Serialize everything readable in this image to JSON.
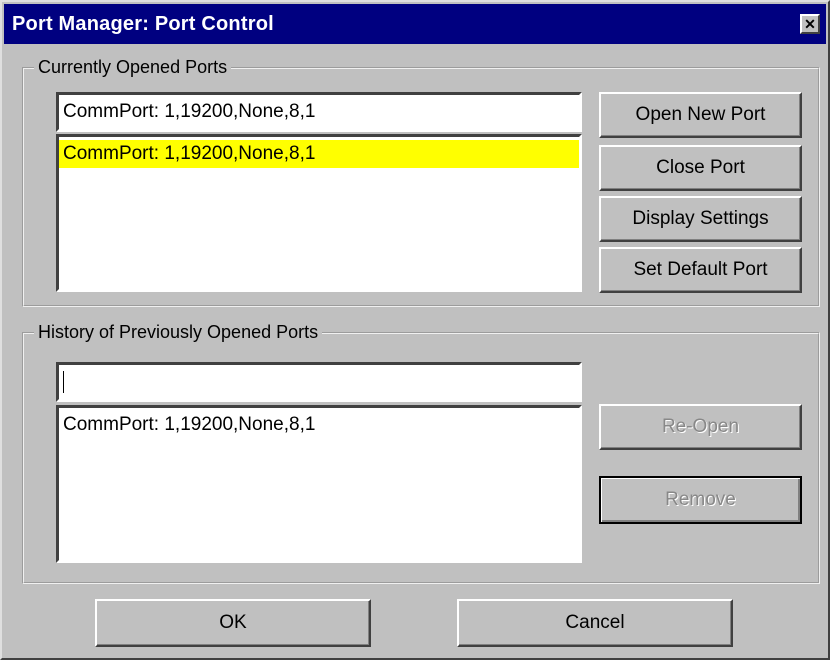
{
  "window": {
    "title": "Port Manager:  Port Control",
    "close_icon": "close-icon"
  },
  "current": {
    "group_label": "Currently Opened Ports",
    "input_value": "CommPort: 1,19200,None,8,1",
    "items": [
      {
        "label": "CommPort: 1,19200,None,8,1",
        "selected": true
      }
    ],
    "buttons": {
      "open_new": "Open New Port",
      "close": "Close Port",
      "display": "Display Settings",
      "set_default": "Set Default Port"
    }
  },
  "history": {
    "group_label": "History of Previously Opened Ports",
    "input_value": "",
    "items": [
      {
        "label": "CommPort: 1,19200,None,8,1"
      }
    ],
    "buttons": {
      "reopen": "Re-Open",
      "remove": "Remove"
    }
  },
  "footer": {
    "ok": "OK",
    "cancel": "Cancel"
  },
  "colors": {
    "titlebar": "#000080",
    "selection": "#ffff00",
    "face": "#c0c0c0"
  }
}
